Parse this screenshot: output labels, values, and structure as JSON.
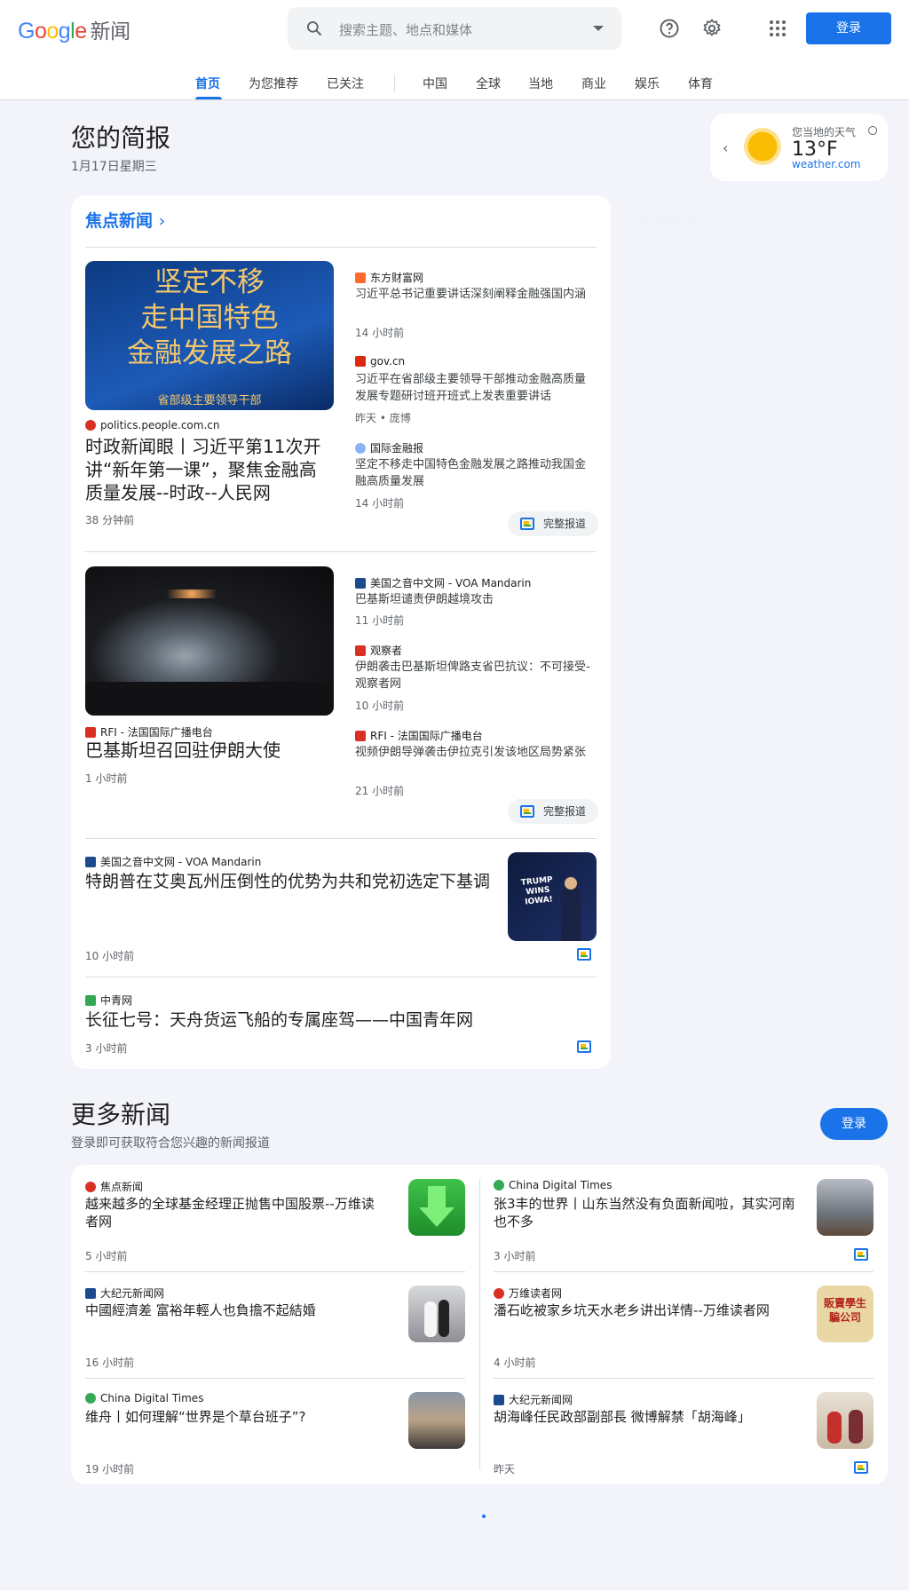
{
  "header": {
    "logo_google": [
      "G",
      "o",
      "o",
      "g",
      "l",
      "e"
    ],
    "logo_suffix": "新闻",
    "search_placeholder": "搜索主题、地点和媒体",
    "login": "登录"
  },
  "nav": {
    "tabs": [
      "首页",
      "为您推荐",
      "已关注",
      "中国",
      "全球",
      "当地",
      "商业",
      "娱乐",
      "体育"
    ],
    "active": "首页"
  },
  "briefing": {
    "title": "您的简报",
    "date": "1月17日星期三"
  },
  "weather": {
    "label": "您当地的天气",
    "temp": "13°F",
    "source": "weather.com"
  },
  "ghost_text": "本地新闻",
  "top_stories": {
    "header": "焦点新闻",
    "cluster1": {
      "image_text": "坚定不移\n走中国特色\n金融发展之路",
      "image_sub": "省部级主要领导干部",
      "source": "politics.people.com.cn",
      "title": "时政新闻眼丨习近平第11次开讲“新年第一课”，聚焦金融高质量发展--时政--人民网",
      "time": "38 分钟前",
      "related": [
        {
          "source": "东方财富网",
          "title": "习近平总书记重要讲话深刻阐释金融强国内涵",
          "time": "14 小时前",
          "color": "#ff6a2c"
        },
        {
          "source": "gov.cn",
          "title": "习近平在省部级主要领导干部推动金融高质量发展专题研讨班开班式上发表重要讲话",
          "time": "昨天 • 庞博",
          "color": "#de2910"
        },
        {
          "source": "国际金融报",
          "title": "坚定不移走中国特色金融发展之路推动我国金融高质量发展",
          "time": "14 小时前",
          "color": "#8ab4f8"
        }
      ],
      "full_coverage": "完整报道"
    },
    "cluster2": {
      "source": "RFI - 法国国际广播电台",
      "title": "巴基斯坦召回驻伊朗大使",
      "time": "1 小时前",
      "related": [
        {
          "source": "美国之音中文网 - VOA Mandarin",
          "title": "巴基斯坦谴责伊朗越境攻击",
          "time": "11 小时前",
          "color": "#1c4a8c"
        },
        {
          "source": "观察者",
          "title": "伊朗袭击巴基斯坦俾路支省巴抗议：不可接受-观察者网",
          "time": "10 小时前",
          "color": "#d93025"
        },
        {
          "source": "RFI - 法国国际广播电台",
          "title": "视频伊朗导弹袭击伊拉克引发该地区局势紧张",
          "time": "21 小时前",
          "color": "#d93025"
        }
      ],
      "full_coverage": "完整报道"
    },
    "story3": {
      "source": "美国之音中文网 - VOA Mandarin",
      "title": "特朗普在艾奥瓦州压倒性的优势为共和党初选定下基调",
      "time": "10 小时前",
      "image_text": "TRUMP\nWINS\nIOWA!"
    },
    "story4": {
      "source": "中青网",
      "title": "长征七号：天舟货运飞船的专属座驾——中国青年网",
      "time": "3 小时前"
    }
  },
  "more_news": {
    "title": "更多新闻",
    "subtitle": "登录即可获取符合您兴趣的新闻报道",
    "login": "登录",
    "items": [
      {
        "source": "焦点新闻",
        "title": "越来越多的全球基金经理正抛售中国股票--万维读者网",
        "time": "5 小时前",
        "color": "#d93025",
        "thumb": "green"
      },
      {
        "source": "China Digital Times",
        "title": "张3丰的世界丨山东当然没有负面新闻啦，其实河南也不多",
        "time": "3 小时前",
        "color": "#34a853",
        "thumb": "storm"
      },
      {
        "source": "大纪元新闻网",
        "title": "中國經濟差 富裕年輕人也負擔不起結婚",
        "time": "16 小时前",
        "color": "#1c4a8c",
        "thumb": "wedding"
      },
      {
        "source": "万维读者网",
        "title": "潘石屹被家乡坑天水老乡讲出详情--万维读者网",
        "time": "4 小时前",
        "color": "#d93025",
        "thumb": "sign",
        "thumb_text": "販賣學生\n騙公司"
      },
      {
        "source": "China Digital Times",
        "title": "维舟丨如何理解“世界是个草台班子”?",
        "time": "19 小时前",
        "color": "#34a853",
        "thumb": "city"
      },
      {
        "source": "大纪元新闻网",
        "title": "胡海峰任民政部副部長 微博解禁「胡海峰」",
        "time": "昨天",
        "color": "#1c4a8c",
        "thumb": "people"
      }
    ]
  }
}
